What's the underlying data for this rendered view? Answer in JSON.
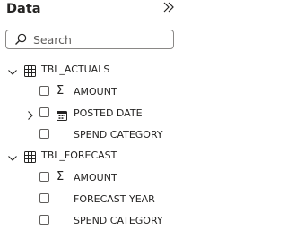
{
  "pane": {
    "title": "Data",
    "collapse_icon": "double-chevron-right-icon"
  },
  "search": {
    "placeholder": "Search",
    "value": ""
  },
  "tables": [
    {
      "name": "TBL_ACTUALS",
      "expanded": true,
      "fields": [
        {
          "label": "AMOUNT",
          "icon": "sigma-icon",
          "checked": false
        },
        {
          "label": "POSTED DATE",
          "icon": "calendar-icon",
          "checked": false,
          "hierarchy": true
        },
        {
          "label": "SPEND CATEGORY",
          "icon": "",
          "checked": false
        }
      ]
    },
    {
      "name": "TBL_FORECAST",
      "expanded": true,
      "fields": [
        {
          "label": "AMOUNT",
          "icon": "sigma-icon",
          "checked": false
        },
        {
          "label": "FORECAST YEAR",
          "icon": "",
          "checked": false
        },
        {
          "label": "SPEND CATEGORY",
          "icon": "",
          "checked": false
        }
      ]
    }
  ]
}
